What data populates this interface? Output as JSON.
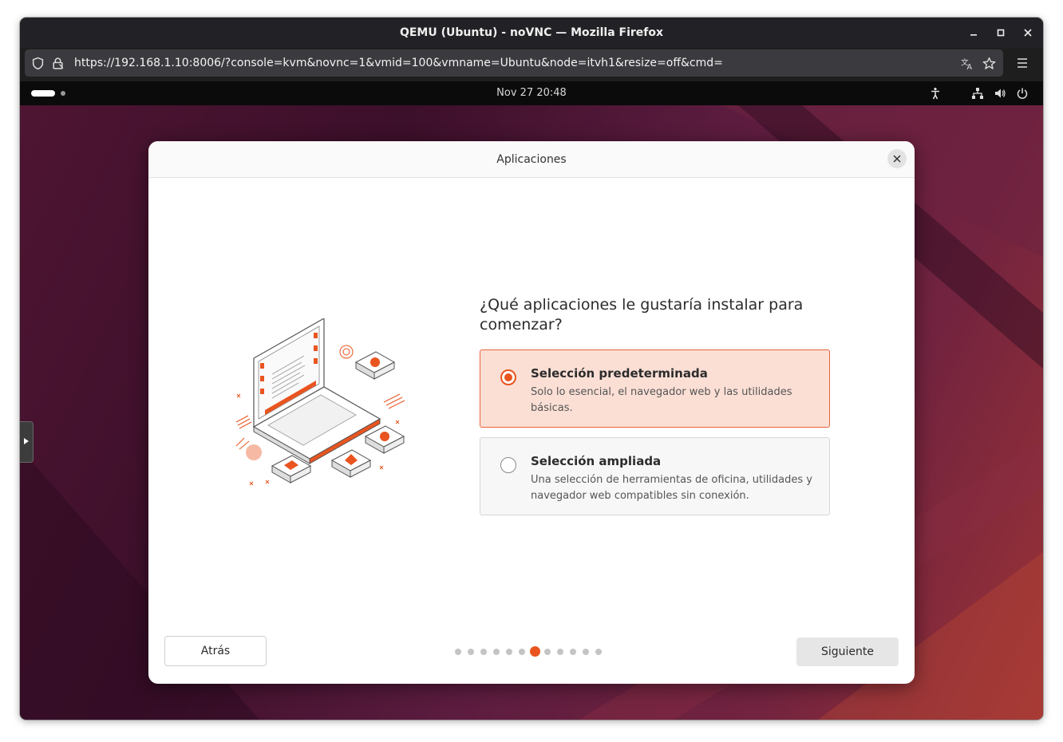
{
  "browser": {
    "window_title": "QEMU (Ubuntu) - noVNC — Mozilla Firefox",
    "url": "https://192.168.1.10:8006/?console=kvm&novnc=1&vmid=100&vmname=Ubuntu&node=itvh1&resize=off&cmd=",
    "icons": [
      "shield-icon",
      "lock-icon",
      "translate-icon",
      "star-icon",
      "menu-icon",
      "minimize-icon",
      "maximize-icon",
      "close-icon"
    ]
  },
  "top_bar": {
    "date": "Nov 27",
    "time": "20:48",
    "clock": "Nov 27  20:48",
    "icons": [
      "accessibility-icon",
      "network-icon",
      "volume-icon",
      "power-icon"
    ]
  },
  "dialog": {
    "title": "Aplicaciones",
    "question": "¿Qué aplicaciones le gustaría instalar para comenzar?",
    "options": [
      {
        "title": "Selección predeterminada",
        "description": "Solo lo esencial, el navegador web y las utilidades básicas.",
        "selected": true
      },
      {
        "title": "Selección ampliada",
        "description": "Una selección de herramientas de oficina, utilidades y navegador web compatibles sin conexión.",
        "selected": false
      }
    ],
    "back_label": "Atrás",
    "next_label": "Siguiente",
    "pager": {
      "total": 12,
      "current": 7
    }
  },
  "colors": {
    "accent": "#E9541F",
    "selected_bg": "#FBDFD5",
    "desktop": "#4E1532"
  }
}
